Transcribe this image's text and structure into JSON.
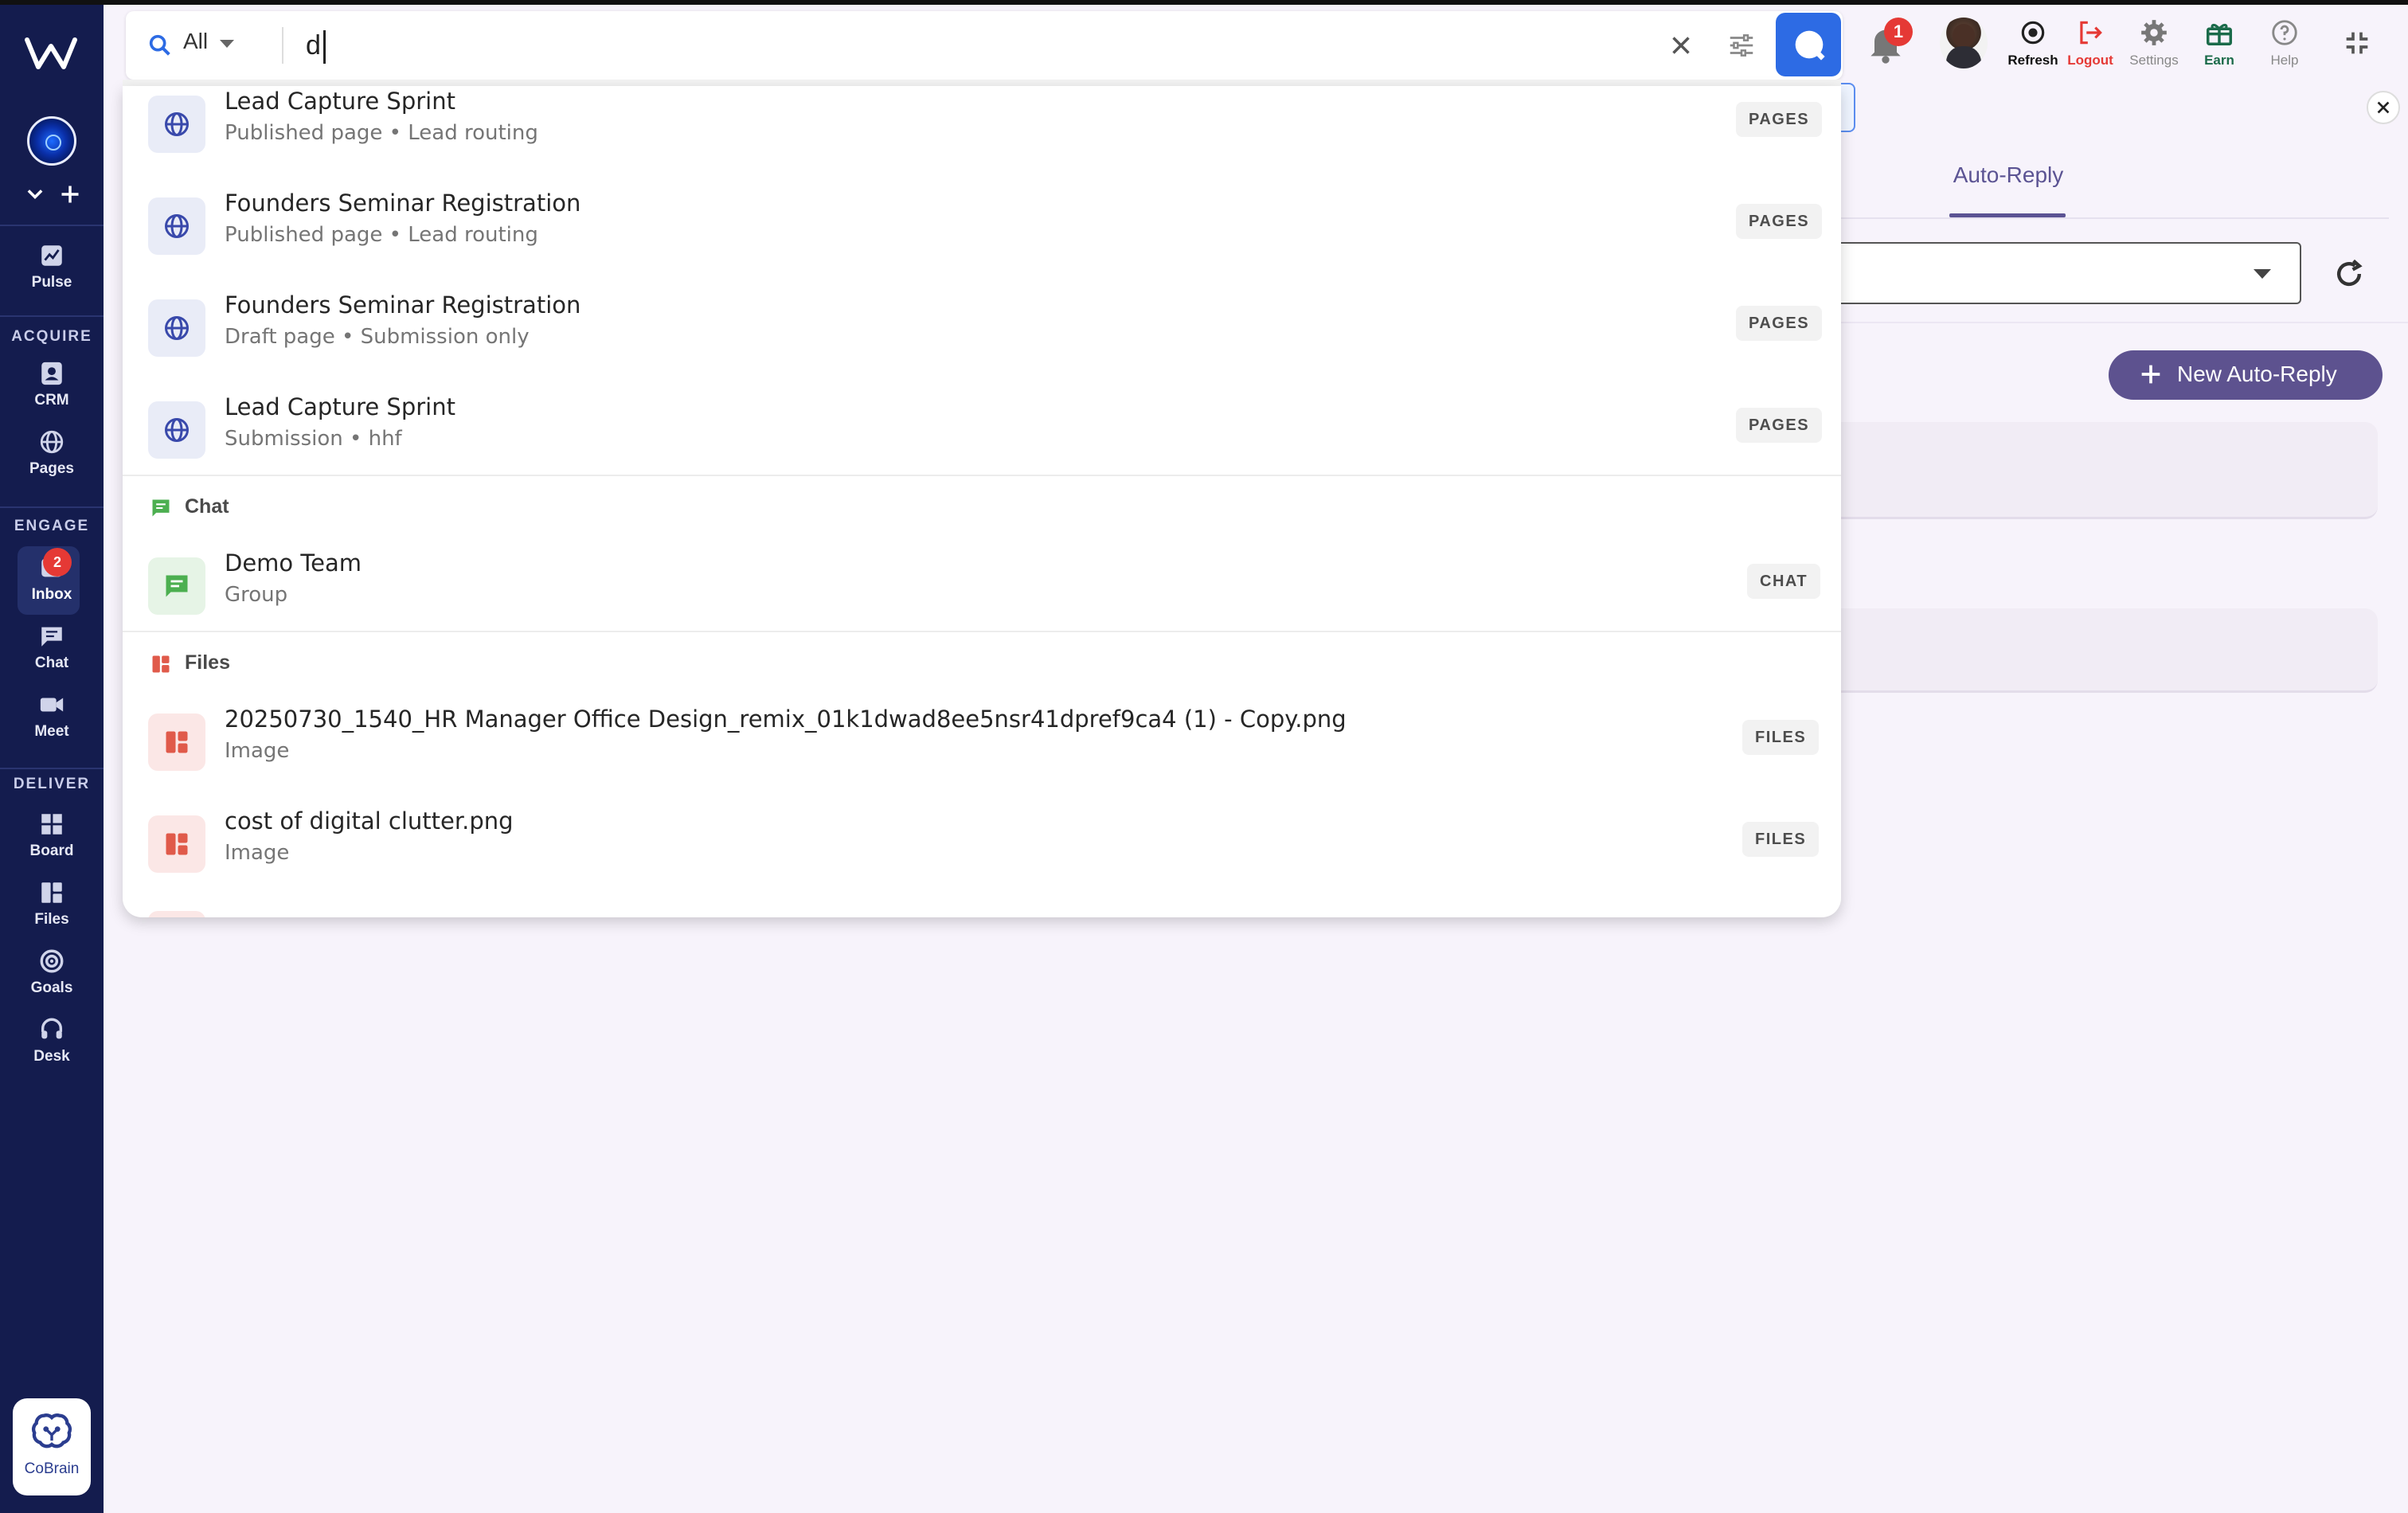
{
  "search": {
    "scope": "All",
    "query": "d"
  },
  "header": {
    "notification_count": "1",
    "refresh_label": "Refresh",
    "logout_label": "Logout",
    "settings_label": "Settings",
    "earn_label": "Earn",
    "help_label": "Help"
  },
  "sidebar": {
    "pulse": "Pulse",
    "acquire": "ACQUIRE",
    "crm": "CRM",
    "pages": "Pages",
    "engage": "ENGAGE",
    "inbox": "Inbox",
    "inbox_badge": "2",
    "chat": "Chat",
    "meet": "Meet",
    "deliver": "DELIVER",
    "board": "Board",
    "files": "Files",
    "goals": "Goals",
    "desk": "Desk",
    "cobrain": "CoBrain"
  },
  "panel": {
    "tab_label": "Auto-Reply",
    "new_button": "New Auto-Reply"
  },
  "results": {
    "pages": [
      {
        "title": "Lead Capture Sprint",
        "subtitle": "Published page • Lead routing",
        "chip": "PAGES"
      },
      {
        "title": "Founders Seminar Registration",
        "subtitle": "Published page • Lead routing",
        "chip": "PAGES"
      },
      {
        "title": "Founders Seminar Registration",
        "subtitle": "Draft page • Submission only",
        "chip": "PAGES"
      },
      {
        "title": "Lead Capture Sprint",
        "subtitle": "Submission • hhf",
        "chip": "PAGES"
      }
    ],
    "chat_header": "Chat",
    "chat": [
      {
        "title": "Demo Team",
        "subtitle": "Group",
        "chip": "CHAT"
      }
    ],
    "files_header": "Files",
    "files": [
      {
        "title": "20250730_1540_HR Manager Office Design_remix_01k1dwad8ee5nsr41dpref9ca4 (1) - Copy.png",
        "subtitle": "Image",
        "chip": "FILES"
      },
      {
        "title": "cost of digital clutter.png",
        "subtitle": "Image",
        "chip": "FILES"
      }
    ]
  },
  "colors": {
    "sidebar_bg": "#141c4e",
    "accent_purple": "#5d528f",
    "search_button": "#2d6be4",
    "badge_red": "#e53935",
    "chat_green": "#4caf50",
    "files_red": "#e05a4a",
    "pages_indigo": "#3949ab"
  },
  "icons": [
    "search-icon",
    "clear-icon",
    "filter-icon",
    "bell-icon",
    "refresh-icon",
    "logout-icon",
    "gear-icon",
    "gift-icon",
    "help-icon",
    "collapse-icon",
    "globe-icon",
    "chat-bubble-icon",
    "files-icon",
    "close-icon"
  ]
}
